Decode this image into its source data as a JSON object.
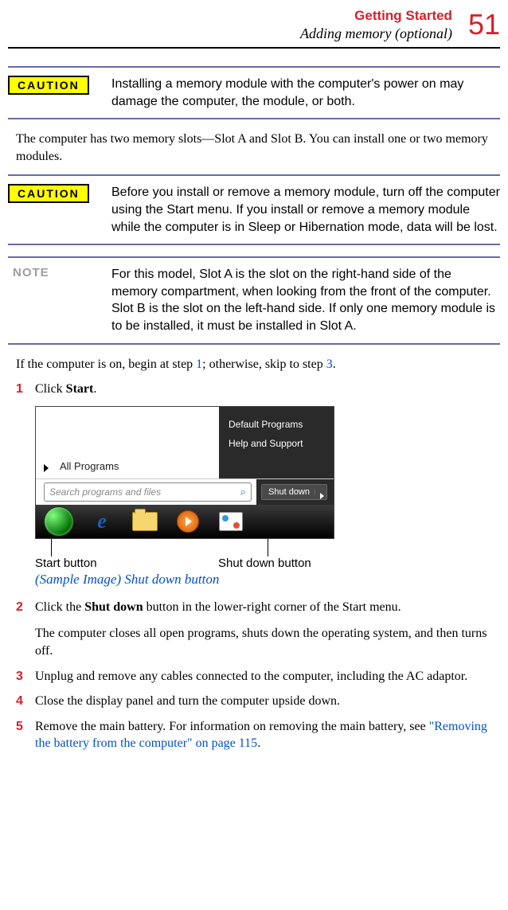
{
  "header": {
    "section": "Getting Started",
    "subsection": "Adding memory (optional)",
    "page_number": "51"
  },
  "callouts": [
    {
      "badge": "CAUTION",
      "type": "caution",
      "text": "Installing a memory module with the computer's power on may damage the computer, the module, or both."
    },
    {
      "badge": "CAUTION",
      "type": "caution",
      "text": "Before you install or remove a memory module, turn off the computer using the Start menu. If you install or remove a memory module while the computer is in Sleep or Hibernation mode, data will be lost."
    },
    {
      "badge": "NOTE",
      "type": "note",
      "text": "For this model, Slot A is the slot on the right-hand side of the memory compartment, when looking from the front of the computer. Slot B is the slot on the left-hand side. If only one memory module is to be installed, it must be installed in Slot A."
    }
  ],
  "paragraph_1": "The computer has two memory slots—Slot A and Slot B. You can install one or two memory modules.",
  "intro": {
    "pre": "If the computer is on, begin at step ",
    "mid": "; otherwise, skip to step ",
    "post": ".",
    "n1": "1",
    "n3": "3"
  },
  "steps": [
    {
      "num": "1",
      "html_pre": "Click ",
      "bold": "Start",
      "html_post": "."
    },
    {
      "num": "2",
      "html_pre": "Click the ",
      "bold": "Shut down",
      "html_post": " button in the lower-right corner of the Start menu.",
      "sub": "The computer closes all open programs, shuts down the operating system, and then turns off."
    },
    {
      "num": "3",
      "text": "Unplug and remove any cables connected to the computer, including the AC adaptor."
    },
    {
      "num": "4",
      "text": "Close the display panel and turn the computer upside down."
    },
    {
      "num": "5",
      "html_pre": "Remove the main battery. For information on removing the main battery, see ",
      "link": "\"Removing the battery from the computer\" on page 115",
      "html_post": "."
    }
  ],
  "figure": {
    "menu_items": [
      "Default Programs",
      "Help and Support"
    ],
    "all_programs": "All Programs",
    "search_placeholder": "Search programs and files",
    "shutdown_label": "Shut down",
    "label_left": "Start button",
    "label_right": "Shut down button",
    "caption": "(Sample Image) Shut down button"
  }
}
